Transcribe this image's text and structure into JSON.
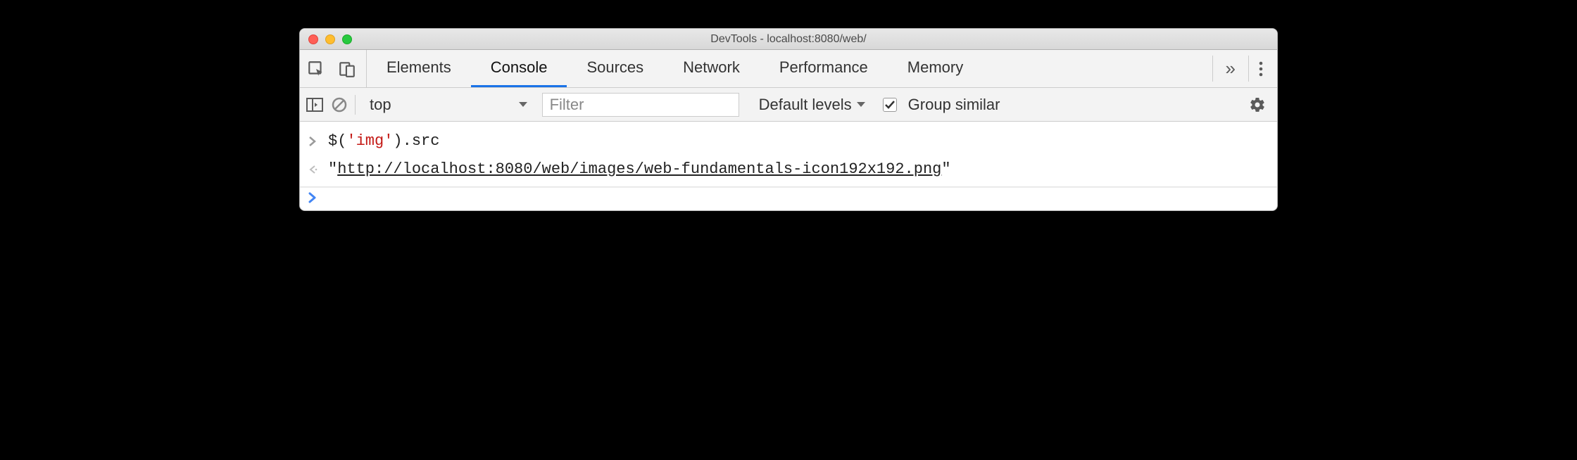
{
  "window": {
    "title": "DevTools - localhost:8080/web/"
  },
  "tabs": {
    "items": [
      "Elements",
      "Console",
      "Sources",
      "Network",
      "Performance",
      "Memory"
    ],
    "activeIndex": 1
  },
  "toolbar": {
    "context": "top",
    "filterPlaceholder": "Filter",
    "levels": "Default levels",
    "groupSimilarChecked": true,
    "groupSimilarLabel": "Group similar"
  },
  "console": {
    "input": {
      "fn": "$",
      "argString": "'img'",
      "prop": ".src"
    },
    "output": {
      "prefixQuote": "\"",
      "url": "http://localhost:8080/web/images/web-fundamentals-icon192x192.png",
      "suffixQuote": "\""
    }
  }
}
